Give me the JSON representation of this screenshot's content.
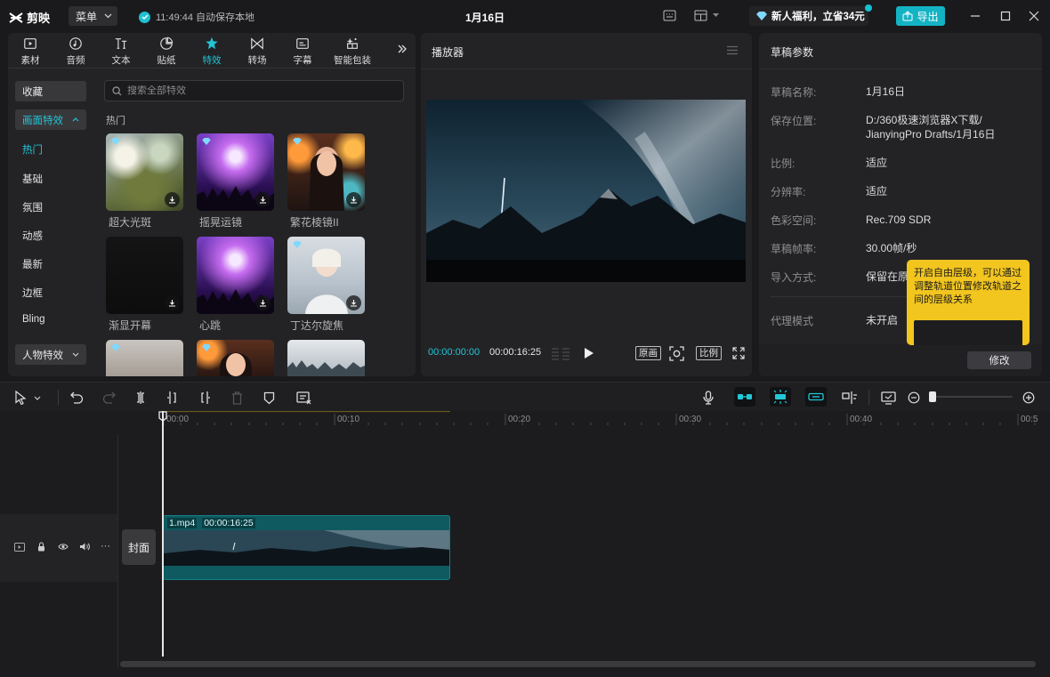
{
  "app": {
    "logo_text": "剪映",
    "menu_label": "菜单",
    "autosave_text": "11:49:44 自动保存本地",
    "window_title": "1月16日",
    "promo_text": "新人福利，立省34元",
    "export_label": "导出"
  },
  "colors": {
    "accent": "#22c6d6",
    "tooltip": "#f2c51f",
    "clip": "#0f5a60"
  },
  "media_tabs": [
    {
      "label": "素材",
      "icon": "media-icon"
    },
    {
      "label": "音频",
      "icon": "audio-icon"
    },
    {
      "label": "文本",
      "icon": "text-icon"
    },
    {
      "label": "贴纸",
      "icon": "sticker-icon"
    },
    {
      "label": "特效",
      "icon": "effects-icon",
      "active": true
    },
    {
      "label": "转场",
      "icon": "transition-icon"
    },
    {
      "label": "字幕",
      "icon": "subtitle-icon"
    },
    {
      "label": "智能包装",
      "icon": "smart-pack-icon"
    }
  ],
  "sidebar": {
    "favorites": "收藏",
    "screen_effects": "画面特效",
    "items": [
      "热门",
      "基础",
      "氛围",
      "动感",
      "最新",
      "边框",
      "Bling"
    ],
    "character_effects": "人物特效"
  },
  "search": {
    "placeholder": "搜索全部特效"
  },
  "effects": {
    "section": "热门",
    "items": [
      "超大光斑",
      "摇晃运镜",
      "繁花棱镜II",
      "渐显开幕",
      "心跳",
      "丁达尔旋焦"
    ]
  },
  "player": {
    "title": "播放器",
    "current_time": "00:00:00:00",
    "total_time": "00:00:16:25",
    "btn_original": "原画",
    "btn_ratio": "比例"
  },
  "draft": {
    "title": "草稿参数",
    "rows": [
      {
        "key": "草稿名称:",
        "value": "1月16日"
      },
      {
        "key": "保存位置:",
        "value": "D:/360极速浏览器X下载/",
        "value2": "JianyingPro Drafts/1月16日"
      },
      {
        "key": "比例:",
        "value": "适应"
      },
      {
        "key": "分辨率:",
        "value": "适应"
      },
      {
        "key": "色彩空间:",
        "value": "Rec.709 SDR"
      },
      {
        "key": "草稿帧率:",
        "value": "30.00帧/秒"
      },
      {
        "key": "导入方式:",
        "value": "保留在原"
      },
      {
        "key": "代理模式",
        "value": "未开启"
      }
    ],
    "modify_label": "修改",
    "tooltip_text": "开启自由层级，可以通过调整轨道位置修改轨道之间的层级关系"
  },
  "timeline": {
    "ruler": [
      "00:00",
      "00:10",
      "00:20",
      "00:30",
      "00:40",
      "00:5"
    ],
    "cover_label": "封面",
    "clip_name": "1.mp4",
    "clip_duration": "00:00:16:25"
  }
}
